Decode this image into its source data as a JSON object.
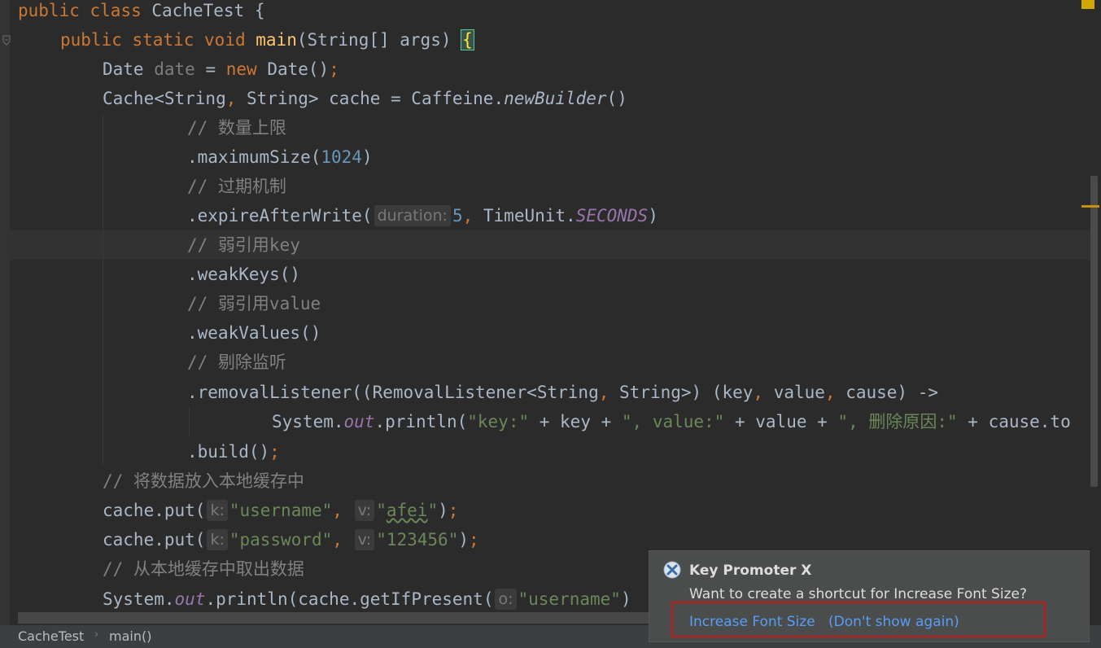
{
  "editor": {
    "class_decl": {
      "kw1": "public",
      "kw2": "class",
      "name": "CacheTest",
      "brace": "{"
    },
    "main_decl": {
      "kw1": "public",
      "kw2": "static",
      "kw3": "void",
      "name": "main",
      "params": "(String[] args)",
      "brace": "{"
    },
    "date_line": {
      "type": "Date",
      "var": "date",
      "eq": " = ",
      "kw": "new",
      "call": " Date()",
      "semi": ";"
    },
    "cache_line": {
      "pre": "Cache<String",
      "comma": ",",
      "mid": " String> cache = Caffeine.",
      "method": "newBuilder",
      "post": "()"
    },
    "c1": "// 数量上限",
    "max_size": {
      "pre": ".maximumSize(",
      "num": "1024",
      "post": ")"
    },
    "c2": "// 过期机制",
    "expire": {
      "pre": ".expireAfterWrite(",
      "hint": "duration:",
      "num": "5",
      "comma": ",",
      "mid": " TimeUnit.",
      "field": "SECONDS",
      "post": ")"
    },
    "c3": "// 弱引用key",
    "weak_keys": ".weakKeys()",
    "c4": "// 弱引用value",
    "weak_values": ".weakValues()",
    "c5": "// 剔除监听",
    "removal": {
      "p1": ".removalListener((RemovalListener<String",
      "c1": ",",
      "p2": " String>) (key",
      "c2": ",",
      "p3": " value",
      "c3": ",",
      "p4": " cause) ->"
    },
    "println1": {
      "p1": "System.",
      "out": "out",
      "p2": ".println(",
      "s1": "\"key:\"",
      "p3": " + key + ",
      "s2": "\", value:\"",
      "p4": " + value + ",
      "s3": "\", 删除原因:\"",
      "p5": " + cause.to"
    },
    "build": {
      "pre": ".build()",
      "semi": ";"
    },
    "c6": "// 将数据放入本地缓存中",
    "put1": {
      "pre": "cache.put(",
      "hint_k": "k:",
      "s1": "\"username\"",
      "comma": ",",
      "hint_v": "v:",
      "s2q1": "\"",
      "s2": "afei",
      "s2q2": "\"",
      "post": ")",
      "semi": ";"
    },
    "put2": {
      "pre": "cache.put(",
      "hint_k": "k:",
      "s1": "\"password\"",
      "comma": ",",
      "hint_v": "v:",
      "s2": "\"123456\"",
      "post": ")",
      "semi": ";"
    },
    "c7": "// 从本地缓存中取出数据",
    "println2": {
      "p1": "System.",
      "out": "out",
      "p2": ".println(cache.getIfPresent(",
      "hint": "o:",
      "s1": "\"username\"",
      "post": ")"
    }
  },
  "breadcrumb": {
    "class": "CacheTest",
    "sep": "›",
    "method": "main()"
  },
  "popup": {
    "title": "Key Promoter X",
    "message": "Want to create a shortcut for Increase Font Size?",
    "action_label": "Increase Font Size",
    "dismiss_label": "(Don't show again)"
  }
}
